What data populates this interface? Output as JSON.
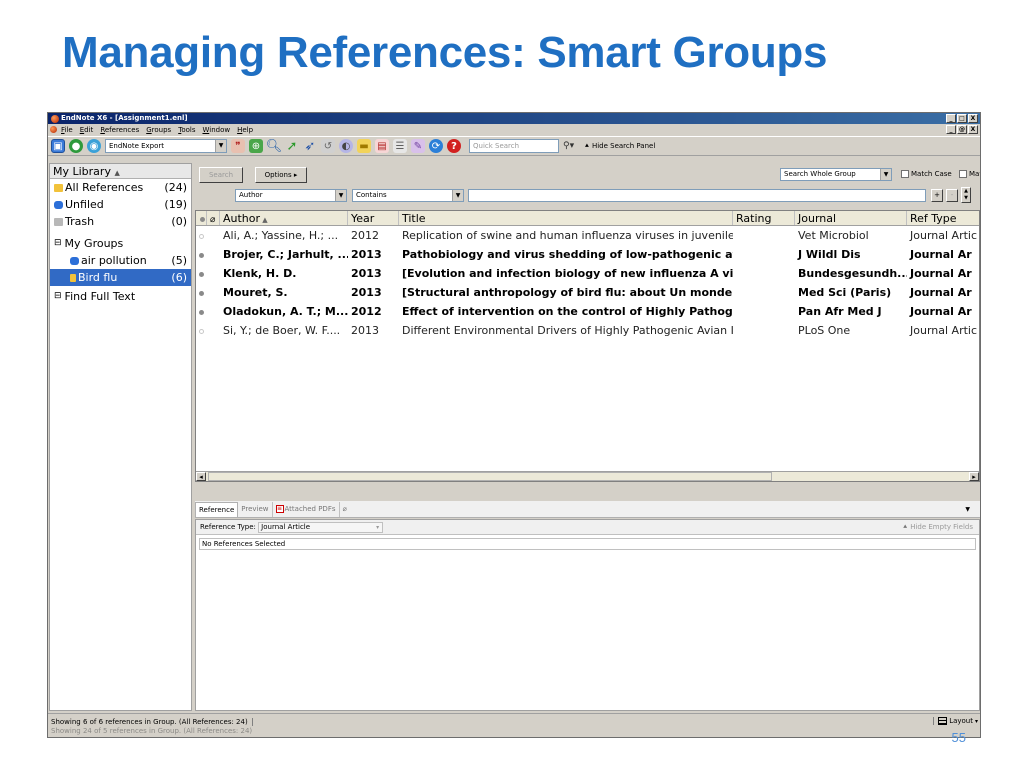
{
  "slide": {
    "title": "Managing References: Smart Groups",
    "number": "55"
  },
  "window": {
    "title": "EndNote X6 - [Assignment1.enl]",
    "buttons": [
      "_",
      "□",
      "X"
    ],
    "doc_buttons": [
      "_",
      "@",
      "X"
    ]
  },
  "menu": [
    "File",
    "Edit",
    "References",
    "Groups",
    "Tools",
    "Window",
    "Help"
  ],
  "toolbar": {
    "style": "EndNote Export",
    "quick_search_placeholder": "Quick Search",
    "hide_search_panel": "Hide Search Panel"
  },
  "sidebar": {
    "header": "My Library",
    "all_references": {
      "label": "All References",
      "count": "(24)"
    },
    "unfiled": {
      "label": "Unfiled",
      "count": "(19)"
    },
    "trash": {
      "label": "Trash",
      "count": "(0)"
    },
    "my_groups": "My Groups",
    "groups": [
      {
        "label": "air pollution",
        "count": "(5)"
      },
      {
        "label": "Bird flu",
        "count": "(6)"
      }
    ],
    "find_full_text": "Find Full Text"
  },
  "search": {
    "search_button": "Search",
    "options_button": "Options",
    "scope": "Search Whole Group",
    "match_case": "Match Case",
    "match_words": "Match Words",
    "field": "Author",
    "operator": "Contains",
    "value": ""
  },
  "table": {
    "columns": {
      "author": "Author",
      "year": "Year",
      "title": "Title",
      "rating": "Rating",
      "journal": "Journal",
      "ref_type": "Ref Type"
    },
    "rows": [
      {
        "author": "Ali, A.; Yassine, H.; ...",
        "year": "2012",
        "title": "Replication of swine and human influenza viruses in juvenile an...",
        "rating": "",
        "journal": "Vet Microbiol",
        "ref_type": "Journal Artic",
        "unread": false
      },
      {
        "author": "Brojer, C.; Jarhult, ...",
        "year": "2013",
        "title": "Pathobiology and virus shedding of low-pathogenic avi...",
        "rating": "",
        "journal": "J Wildl Dis",
        "ref_type": "Journal Ar",
        "unread": true
      },
      {
        "author": "Klenk, H. D.",
        "year": "2013",
        "title": "[Evolution and infection biology of new influenza A vir...",
        "rating": "",
        "journal": "Bundesgesundh...",
        "ref_type": "Journal Ar",
        "unread": true
      },
      {
        "author": "Mouret, S.",
        "year": "2013",
        "title": "[Structural anthropology of bird flu: about Un monde g...",
        "rating": "",
        "journal": "Med Sci (Paris)",
        "ref_type": "Journal Ar",
        "unread": true
      },
      {
        "author": "Oladokun, A. T.; M...",
        "year": "2012",
        "title": "Effect of intervention on the control of Highly Pathoge...",
        "rating": "",
        "journal": "Pan Afr Med J",
        "ref_type": "Journal Ar",
        "unread": true
      },
      {
        "author": "Si, Y.; de Boer, W. F....",
        "year": "2013",
        "title": "Different Environmental Drivers of Highly Pathogenic Avian Infl...",
        "rating": "",
        "journal": "PLoS One",
        "ref_type": "Journal Artic",
        "unread": false
      }
    ]
  },
  "tabs": {
    "reference": "Reference",
    "preview": "Preview",
    "attached_pdfs": "Attached PDFs"
  },
  "reference_panel": {
    "type_label": "Reference Type:",
    "type_value": "Journal Article",
    "hide_empty": "Hide Empty Fields",
    "no_selection": "No References Selected"
  },
  "status": {
    "text": "Showing 6 of 6 references in Group. (All References: 24)",
    "ghost": "Showing 24 of 5 references in Group. (All References: 24)",
    "layout": "Layout"
  },
  "colors": {
    "title_blue": "#1f6fc2",
    "selection": "#316ac5"
  }
}
